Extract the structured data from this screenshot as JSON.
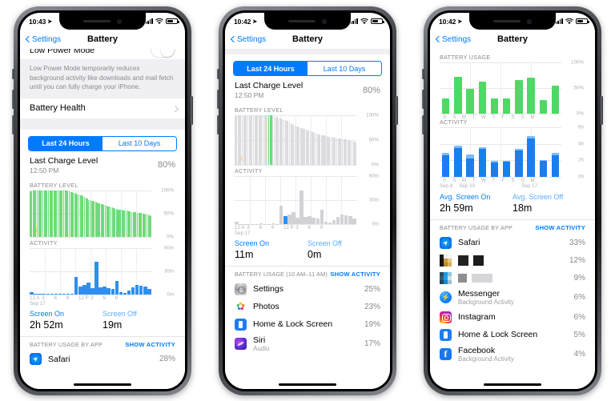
{
  "phones": [
    {
      "id": "phone-1",
      "statusbar": {
        "time": "10:43",
        "location_icon": "location-arrow-icon",
        "signal_icon": "cellular-bars-icon",
        "wifi_icon": "wifi-icon",
        "battery_icon": "battery-icon"
      },
      "nav": {
        "back_label": "Settings",
        "title": "Battery"
      },
      "low_power_mode": {
        "label": "Low Power Mode",
        "toggle_state": "off"
      },
      "footer_note": "Low Power Mode temporarily reduces background activity like downloads and mail fetch until you can fully charge your iPhone.",
      "battery_health": {
        "label": "Battery Health",
        "chevron": "chevron-right-icon"
      },
      "segmented": {
        "options": [
          "Last 24 Hours",
          "Last 10 Days"
        ],
        "selected": "Last 24 Hours"
      },
      "last_charge": {
        "title": "Last Charge Level",
        "time": "12:50 PM",
        "percent": "80%"
      },
      "screen_on": {
        "label": "Screen On",
        "value": "2h 52m"
      },
      "screen_off": {
        "label": "Screen Off",
        "value": "19m"
      },
      "usage_header": {
        "title": "BATTERY USAGE BY APP",
        "action": "SHOW ACTIVITY"
      },
      "apps": [
        {
          "name": "Safari",
          "sub": "",
          "percent": "28%",
          "icon": "safari-icon"
        }
      ],
      "chart_battery": {
        "type": "area",
        "title": "BATTERY LEVEL",
        "ylabels": [
          "100%",
          "50%",
          "0%"
        ],
        "ylim": [
          0,
          100
        ],
        "charge_marker_icon": "charging-bolt-icon",
        "accent": "#6edb78",
        "values": [
          98,
          99,
          100,
          100,
          100,
          100,
          100,
          100,
          100,
          100,
          100,
          100,
          100,
          100,
          100,
          100,
          100,
          100,
          100,
          100,
          100,
          100,
          100,
          100,
          100,
          100,
          100,
          99,
          98,
          97,
          96,
          95,
          94,
          93,
          92,
          91,
          90,
          89,
          88,
          86,
          84,
          82,
          80,
          79,
          78,
          77,
          76,
          75,
          74,
          73,
          72,
          71,
          70,
          69,
          68,
          67,
          66,
          65,
          64,
          63,
          62,
          61,
          60,
          59,
          59,
          58,
          58,
          57,
          57,
          56,
          56,
          55,
          55,
          54,
          54,
          53,
          53,
          52,
          52,
          51,
          51,
          50,
          50,
          49,
          48,
          47,
          46,
          45
        ]
      },
      "chart_activity": {
        "type": "bar",
        "title": "ACTIVITY",
        "ylabels": [
          "60m",
          "30m",
          "0m"
        ],
        "ylim": [
          0,
          60
        ],
        "xlabels": [
          "12 A",
          "3",
          "6",
          "9",
          "12 P",
          "3",
          "6",
          "9"
        ],
        "xdate": "Sep 17",
        "accent": "#2f8ef0",
        "values": [
          3,
          0,
          0,
          0,
          0,
          0,
          1,
          0,
          0,
          1,
          0,
          23,
          10,
          12,
          15,
          8,
          42,
          9,
          10,
          8,
          7,
          18,
          3,
          2,
          5,
          9,
          12,
          11,
          10,
          7
        ]
      }
    },
    {
      "id": "phone-2",
      "statusbar": {
        "time": "10:42",
        "location_icon": "location-arrow-icon",
        "signal_icon": "cellular-bars-icon",
        "wifi_icon": "wifi-icon",
        "battery_icon": "battery-icon"
      },
      "nav": {
        "back_label": "Settings",
        "title": "Battery"
      },
      "segmented": {
        "options": [
          "Last 24 Hours",
          "Last 10 Days"
        ],
        "selected": "Last 24 Hours"
      },
      "last_charge": {
        "title": "Last Charge Level",
        "time": "12:50 PM",
        "percent": "80%"
      },
      "screen_on": {
        "label": "Screen On",
        "value": "11m"
      },
      "screen_off": {
        "label": "Screen Off",
        "value": "0m"
      },
      "usage_header": {
        "title": "BATTERY USAGE (10 AM–11 AM)",
        "action": "SHOW ACTIVITY"
      },
      "apps": [
        {
          "name": "Settings",
          "sub": "",
          "percent": "25%",
          "icon": "settings-icon"
        },
        {
          "name": "Photos",
          "sub": "",
          "percent": "23%",
          "icon": "photos-icon"
        },
        {
          "name": "Home & Lock Screen",
          "sub": "",
          "percent": "19%",
          "icon": "home-lock-screen-icon"
        },
        {
          "name": "Siri",
          "sub": "Audio",
          "percent": "17%",
          "icon": "siri-icon"
        }
      ],
      "chart_battery": {
        "type": "area",
        "title": "BATTERY LEVEL",
        "ylabels": [
          "100%",
          "50%",
          "0%"
        ],
        "ylim": [
          0,
          100
        ],
        "charge_marker_icon": "charging-bolt-icon",
        "accent": "#6edb78",
        "dim": "#dcdce0",
        "selected_index": [
          24,
          25,
          26
        ],
        "values": [
          98,
          99,
          100,
          100,
          100,
          100,
          100,
          100,
          100,
          100,
          100,
          100,
          100,
          100,
          100,
          100,
          100,
          100,
          100,
          100,
          100,
          100,
          100,
          100,
          100,
          100,
          100,
          99,
          98,
          97,
          96,
          95,
          94,
          93,
          92,
          91,
          90,
          89,
          88,
          86,
          84,
          82,
          80,
          79,
          78,
          77,
          76,
          75,
          74,
          73,
          72,
          71,
          70,
          69,
          68,
          67,
          66,
          65,
          64,
          63,
          62,
          61,
          60,
          59,
          59,
          58,
          58,
          57,
          57,
          56,
          56,
          55,
          55,
          54,
          54,
          53,
          53,
          52,
          52,
          51,
          51,
          50,
          50,
          49,
          48,
          47,
          46,
          45
        ]
      },
      "chart_activity": {
        "type": "bar",
        "title": "ACTIVITY",
        "ylabels": [
          "60m",
          "30m",
          "0m"
        ],
        "ylim": [
          0,
          60
        ],
        "xlabels": [
          "12 A",
          "3",
          "6",
          "9",
          "12 P",
          "3",
          "6",
          "9"
        ],
        "xdate": "Sep 17",
        "accent": "#2f8ef0",
        "dim": "#d2d2d6",
        "selected_index": 12,
        "values": [
          3,
          0,
          0,
          0,
          0,
          0,
          1,
          0,
          0,
          1,
          0,
          23,
          10,
          12,
          15,
          8,
          42,
          9,
          10,
          8,
          7,
          18,
          3,
          2,
          5,
          9,
          12,
          11,
          10,
          7
        ]
      }
    },
    {
      "id": "phone-3",
      "statusbar": {
        "time": "10:42",
        "location_icon": "location-arrow-icon",
        "signal_icon": "cellular-bars-icon",
        "wifi_icon": "wifi-icon",
        "battery_icon": "battery-icon"
      },
      "nav": {
        "back_label": "Settings",
        "title": "Battery"
      },
      "screen_on": {
        "label": "Avg. Screen On",
        "value": "2h 59m"
      },
      "screen_off": {
        "label": "Avg. Screen Off",
        "value": "18m"
      },
      "usage_header": {
        "title": "BATTERY USAGE BY APP",
        "action": "SHOW ACTIVITY"
      },
      "apps": [
        {
          "name": "Safari",
          "sub": "",
          "percent": "33%",
          "icon": "safari-icon"
        },
        {
          "name": "",
          "sub": "",
          "percent": "12%",
          "icon": "redacted-icon",
          "redacted": true
        },
        {
          "name": "",
          "sub": "",
          "percent": "9%",
          "icon": "redacted-icon",
          "redacted": true
        },
        {
          "name": "Messenger",
          "sub": "Background Activity",
          "percent": "6%",
          "icon": "messenger-icon"
        },
        {
          "name": "Instagram",
          "sub": "",
          "percent": "6%",
          "icon": "instagram-icon"
        },
        {
          "name": "Home & Lock Screen",
          "sub": "",
          "percent": "5%",
          "icon": "home-lock-screen-icon"
        },
        {
          "name": "Facebook",
          "sub": "Background Activity",
          "percent": "4%",
          "icon": "facebook-icon"
        }
      ],
      "chart_usage": {
        "type": "bar",
        "title": "BATTERY USAGE",
        "ylabels": [
          "100%",
          "50%",
          "0%"
        ],
        "ylim": [
          0,
          100
        ],
        "accent": "#4ed964",
        "categories": [
          "S",
          "S",
          "M",
          "T",
          "W",
          "T",
          "F",
          "S",
          "S",
          "M"
        ],
        "values": [
          30,
          72,
          48,
          62,
          30,
          29,
          65,
          70,
          27,
          55
        ]
      },
      "chart_activity": {
        "type": "bar",
        "title": "ACTIVITY",
        "ylabels": [
          "6h",
          "4h",
          "2h",
          "0h"
        ],
        "ylim": [
          0,
          6
        ],
        "accent": "#1a7ef0",
        "accent_light": "#79bdf7",
        "categories": [
          "S",
          "S",
          "M",
          "T",
          "W",
          "T",
          "F",
          "S",
          "S",
          "M"
        ],
        "xdates": [
          "Sep 8",
          "Sep 10",
          "Sep 17"
        ],
        "series": [
          {
            "name": "Screen On",
            "values": [
              2.6,
              3.5,
              2.2,
              3.4,
              1.7,
              1.8,
              3.2,
              4.6,
              1.9,
              2.6
            ]
          },
          {
            "name": "Screen Off",
            "values": [
              0.3,
              0.25,
              0.5,
              0.2,
              0.2,
              0.15,
              0.2,
              0.35,
              0.15,
              0.35
            ]
          }
        ]
      }
    }
  ]
}
